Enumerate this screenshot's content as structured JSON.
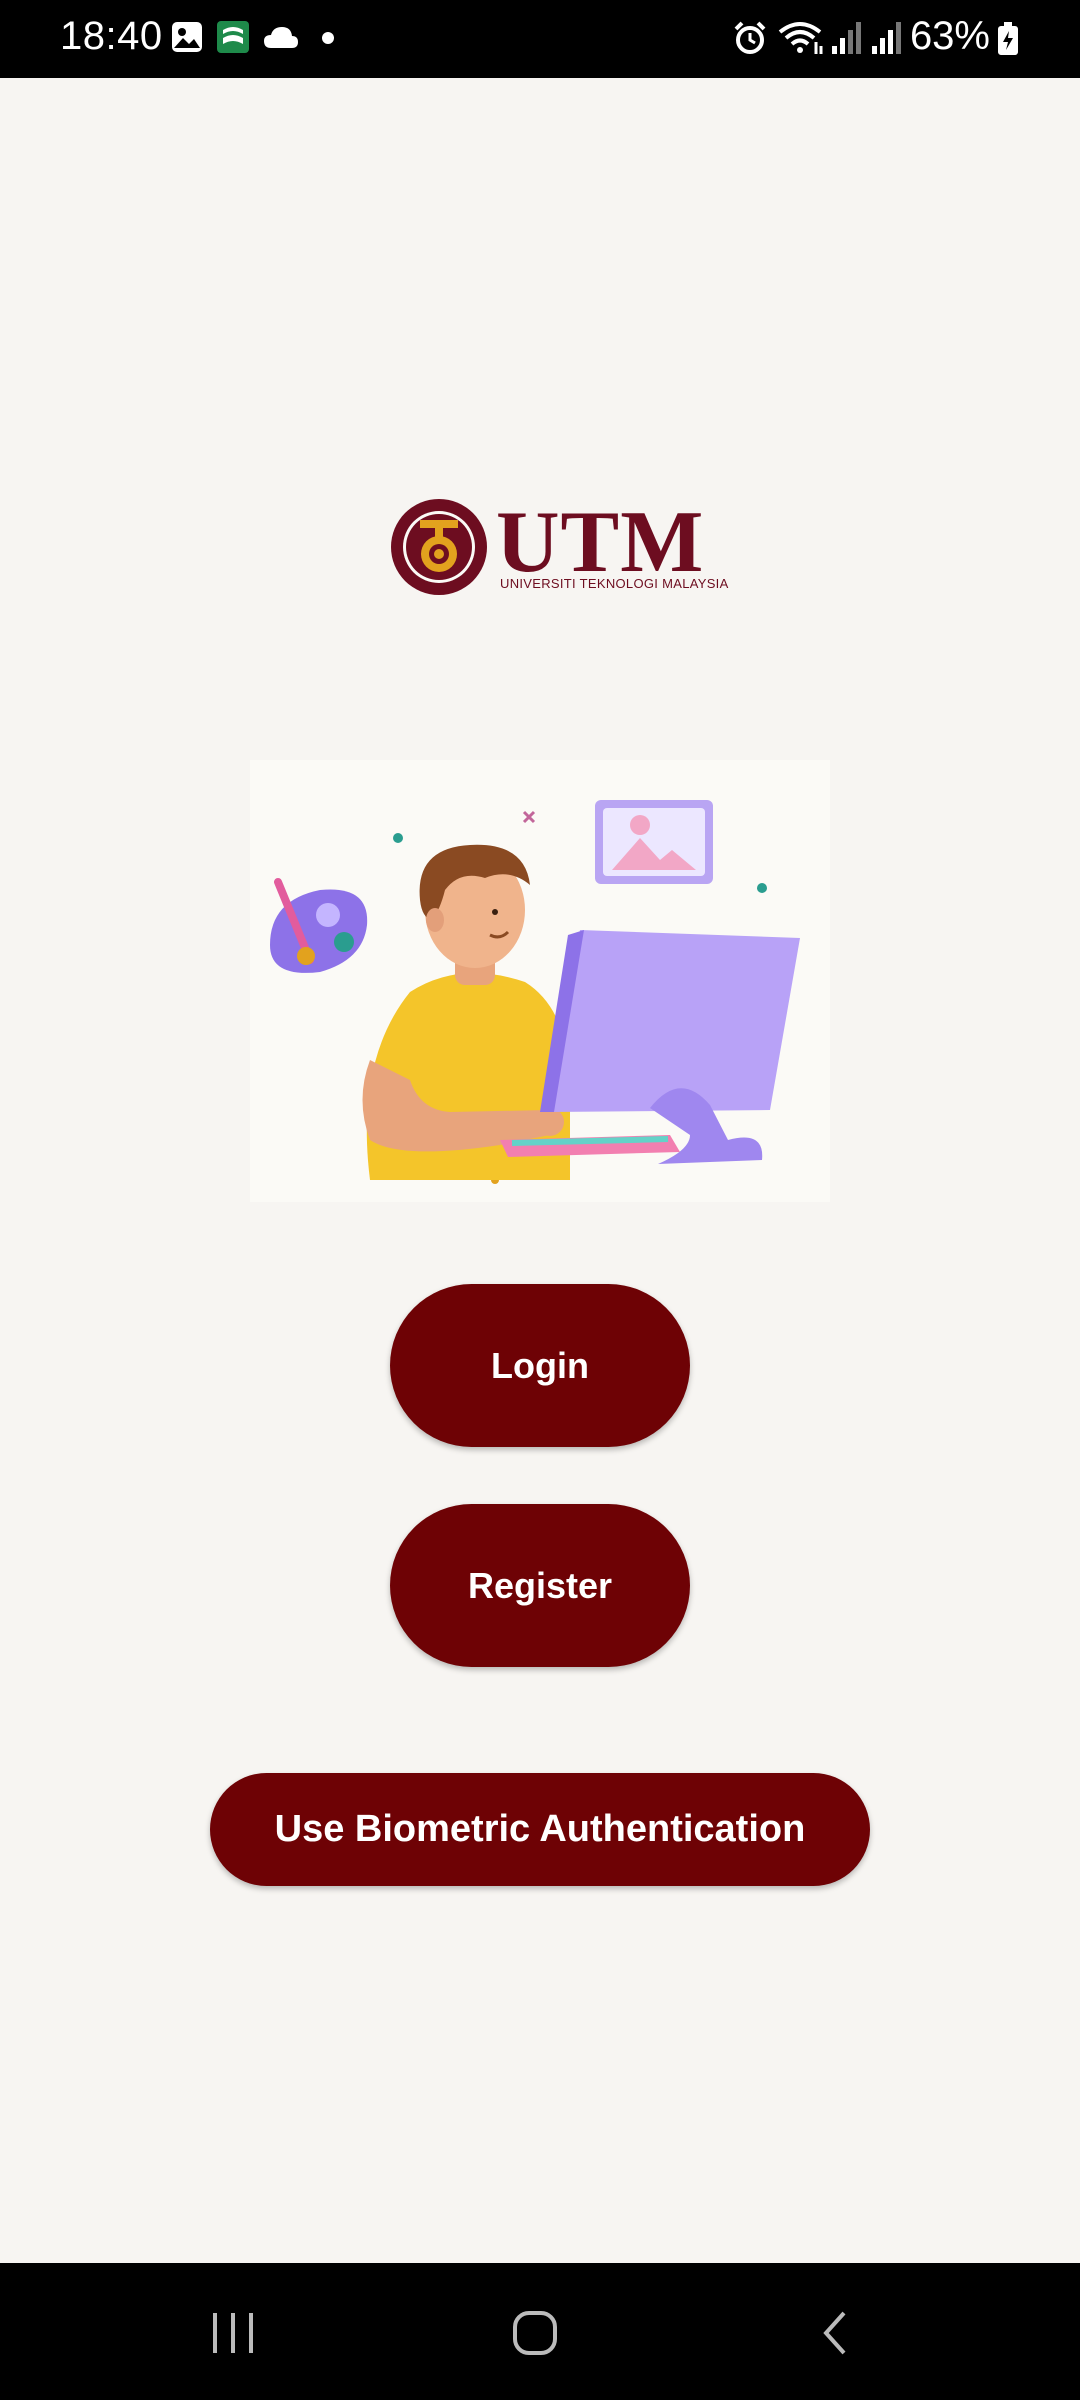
{
  "status_bar": {
    "time": "18:40",
    "battery_percent": "63%",
    "icons": [
      "gallery-icon",
      "app-icon",
      "cloud-icon",
      "dot-icon",
      "alarm-icon",
      "wifi-icon",
      "signal-icon",
      "signal-icon",
      "battery-icon"
    ]
  },
  "logo": {
    "wordmark": "UTM",
    "subtitle": "UNIVERSITI TEKNOLOGI MALAYSIA",
    "brand_color": "#6d0d20"
  },
  "illustration": {
    "subject": "person-at-computer-illustration"
  },
  "buttons": {
    "login_label": "Login",
    "register_label": "Register",
    "biometric_label": "Use Biometric Authentication",
    "color": "#6e0205"
  },
  "nav_bar": {
    "icons": [
      "recent-apps-icon",
      "home-icon",
      "back-icon"
    ]
  }
}
